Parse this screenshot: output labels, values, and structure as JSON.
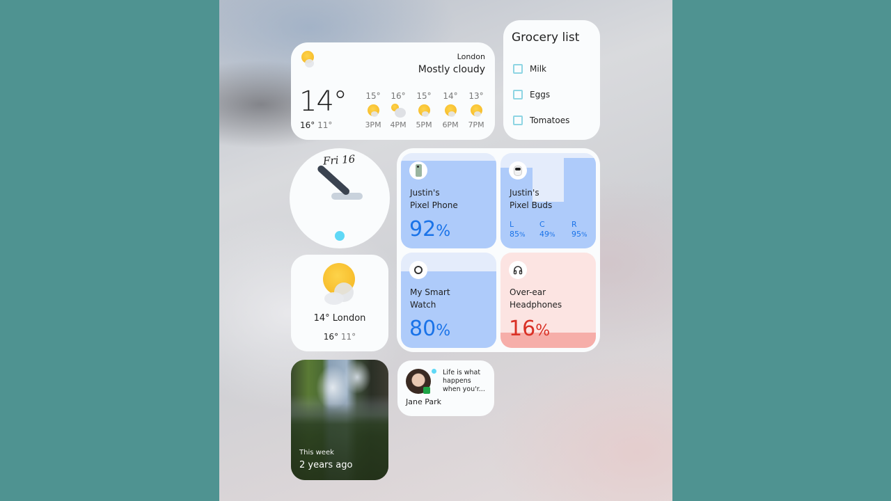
{
  "weather_widget": {
    "icon": "partly-cloudy-icon",
    "city": "London",
    "condition": "Mostly cloudy",
    "current_temp": "14°",
    "high": "16°",
    "low": "11°",
    "hourly": [
      {
        "temp": "15°",
        "time": "3PM",
        "icon": "partly-sunny-icon"
      },
      {
        "temp": "16°",
        "time": "4PM",
        "icon": "mostly-cloudy-icon"
      },
      {
        "temp": "15°",
        "time": "5PM",
        "icon": "partly-sunny-icon"
      },
      {
        "temp": "14°",
        "time": "6PM",
        "icon": "partly-sunny-icon"
      },
      {
        "temp": "13°",
        "time": "7PM",
        "icon": "partly-sunny-icon"
      }
    ]
  },
  "grocery_list": {
    "title": "Grocery list",
    "items": [
      {
        "label": "Milk",
        "checked": false
      },
      {
        "label": "Eggs",
        "checked": false
      },
      {
        "label": "Tomatoes",
        "checked": false
      }
    ],
    "checkbox_color": "#8ed5e3"
  },
  "clock_widget": {
    "date": "Fri 16"
  },
  "weather_small": {
    "summary": "14° London",
    "high": "16°",
    "low": "11°"
  },
  "battery_widget": {
    "devices": [
      {
        "name_line1": "Justin's",
        "name_line2": "Pixel Phone",
        "percent": 92,
        "percent_label": "92",
        "icon": "phone-icon"
      },
      {
        "name_line1": "Justin's",
        "name_line2": "Pixel Buds",
        "icon": "earbuds-icon",
        "buds": [
          {
            "side": "L",
            "percent": 85,
            "percent_label": "85"
          },
          {
            "side": "C",
            "percent": 49,
            "percent_label": "49"
          },
          {
            "side": "R",
            "percent": 95,
            "percent_label": "95"
          }
        ]
      },
      {
        "name_line1": "My Smart",
        "name_line2": "Watch",
        "percent": 80,
        "percent_label": "80",
        "icon": "watch-icon"
      },
      {
        "name_line1": "Over-ear",
        "name_line2": "Headphones",
        "percent": 16,
        "percent_label": "16",
        "icon": "headphones-icon",
        "low_battery": true
      }
    ],
    "percent_symbol": "%",
    "colors": {
      "fill": "#aecbfa",
      "empty": "#e4ecfb",
      "text": "#1a73e8",
      "low_fill": "#f6aea9",
      "low_empty": "#fce4e2",
      "low_text": "#d93025"
    }
  },
  "photo_widget": {
    "caption_small": "This week",
    "caption_large": "2 years ago"
  },
  "conversation_widget": {
    "message": "Life is what happens when you'r...",
    "contact": "Jane Park"
  }
}
